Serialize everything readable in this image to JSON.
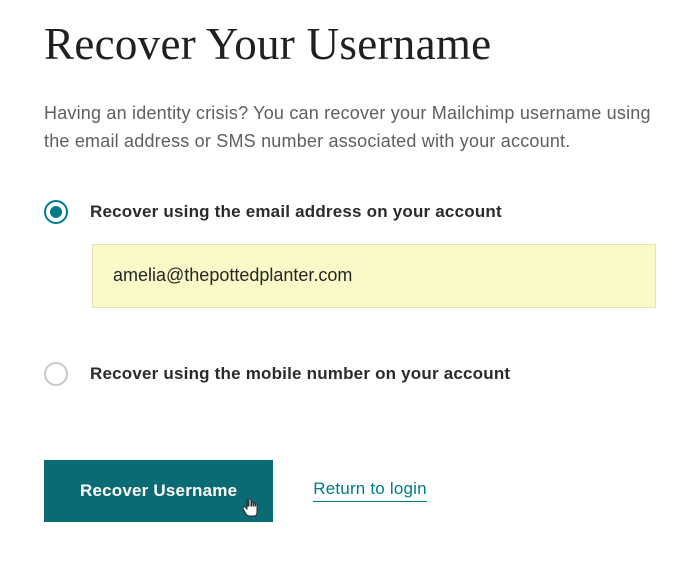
{
  "header": {
    "title": "Recover Your Username"
  },
  "intro": {
    "text": "Having an identity crisis? You can recover your Mailchimp username using the email address or SMS number associated with your account."
  },
  "options": {
    "email": {
      "label": "Recover using the email address on your account",
      "value": "amelia@thepottedplanter.com",
      "selected": true
    },
    "mobile": {
      "label": "Recover using the mobile number on your account",
      "selected": false
    }
  },
  "actions": {
    "submit_label": "Recover Username",
    "return_label": "Return to login"
  },
  "colors": {
    "accent": "#007c89",
    "button": "#0b6b74",
    "highlight_bg": "#fbf9c7"
  }
}
